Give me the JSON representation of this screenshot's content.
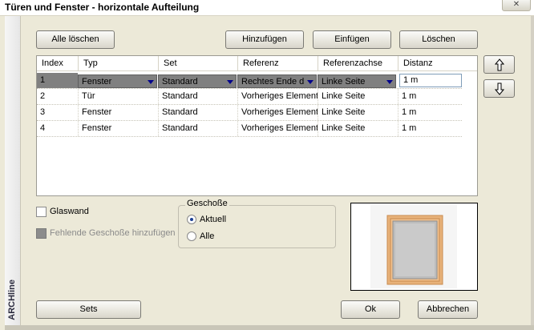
{
  "window": {
    "title": "Türen und Fenster - horizontale Aufteilung",
    "close_label": "✕",
    "side_label": "ARCHline"
  },
  "toolbar": {
    "clear_all_label": "Alle löschen",
    "add_label": "Hinzufügen",
    "insert_label": "Einfügen",
    "delete_label": "Löschen"
  },
  "move_buttons": {
    "up_icon": "arrow-up-icon",
    "down_icon": "arrow-down-icon"
  },
  "table": {
    "columns": [
      "Index",
      "Typ",
      "Set",
      "Referenz",
      "Referenzachse",
      "Distanz"
    ],
    "rows": [
      {
        "index": "1",
        "typ": "Fenster",
        "set": "Standard",
        "referenz": "Rechtes Ende d",
        "referenzachse": "Linke Seite",
        "distanz": "1 m"
      },
      {
        "index": "2",
        "typ": "Tür",
        "set": "Standard",
        "referenz": "Vorheriges Element",
        "referenzachse": "Linke Seite",
        "distanz": "1 m"
      },
      {
        "index": "3",
        "typ": "Fenster",
        "set": "Standard",
        "referenz": "Vorheriges Element",
        "referenzachse": "Linke Seite",
        "distanz": "1 m"
      },
      {
        "index": "4",
        "typ": "Fenster",
        "set": "Standard",
        "referenz": "Vorheriges Element",
        "referenzachse": "Linke Seite",
        "distanz": "1 m"
      }
    ]
  },
  "options": {
    "glaswand_label": "Glaswand",
    "fehlende_label": "Fehlende Geschoße hinzufügen"
  },
  "geschosse": {
    "legend": "Geschoße",
    "aktuell_label": "Aktuell",
    "alle_label": "Alle"
  },
  "footer": {
    "sets_label": "Sets",
    "ok_label": "Ok",
    "cancel_label": "Abbrechen"
  },
  "colors": {
    "window_bg": "#ece9d8",
    "selected_cell": "#808080",
    "frame_wood": "#e8b27a"
  }
}
